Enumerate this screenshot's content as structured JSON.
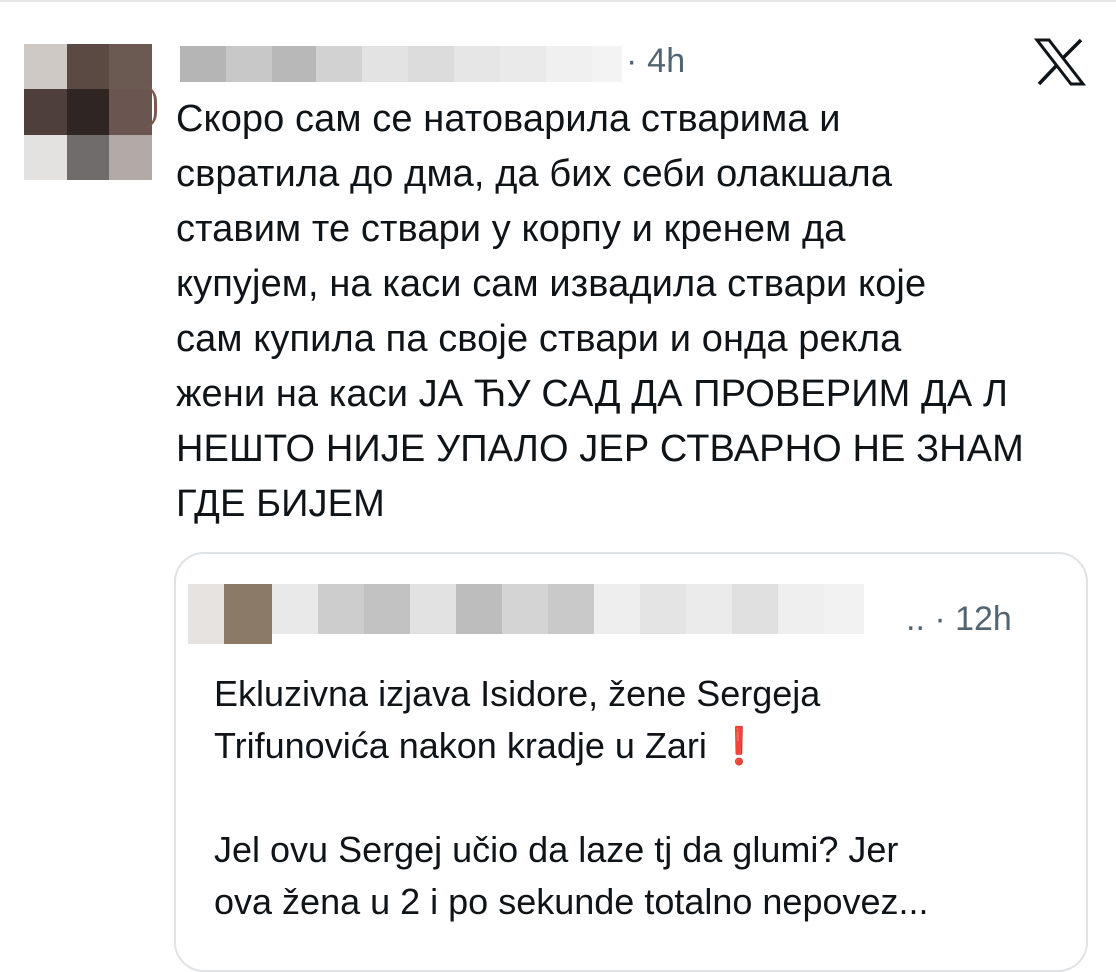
{
  "tweet": {
    "time": "· 4h",
    "text": "Скоро сам се натоварила стварима и\nсвратила до дма, да бих себи олакшала\nставим те ствари у корпу и кренем да\nкупујем, на каси сам извадила ствари које\nсам купила па своје ствари и онда рекла\nжени на каси ЈА ЋУ САД ДА ПРОВЕРИМ ДА Л\nНЕШТО НИЈЕ УПАЛО ЈЕР СТВАРНО НЕ ЗНАМ\nГДЕ БИЈЕМ"
  },
  "quote": {
    "time": ".. · 12h",
    "text_line1": "Ekluzivna izjava Isidore, žene Sergeja\nTrifunovića nakon kradje u Zari ",
    "emoji": "❗",
    "text_line2": "\n\nJel ovu Sergej učio da laze tj da glumi? Jer\nova žena u 2 i po sekunde totalno nepovez..."
  },
  "logo": "x-logo-icon",
  "colors": {
    "text": "#0f1419",
    "muted": "#536471",
    "border": "#dfe3e6",
    "emoji": "#e0232e"
  }
}
